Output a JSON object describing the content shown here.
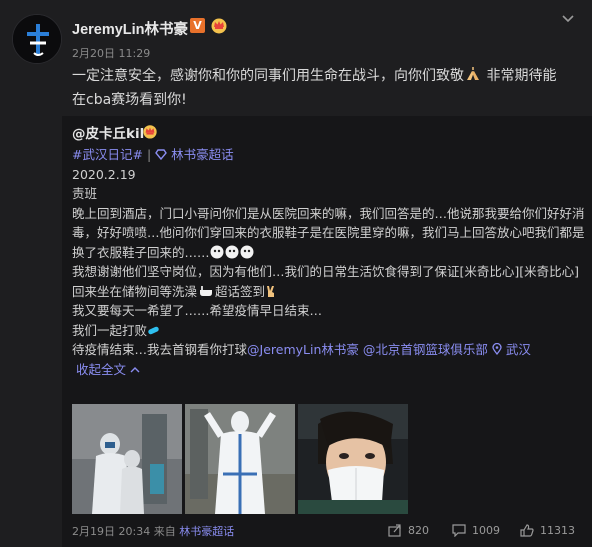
{
  "post": {
    "author": "JeremyLin林书豪",
    "verified_badge": "V",
    "timestamp": "2月20日 11:29",
    "text_line1": "一定注意安全，感谢你和你的同事们用生命在战斗，向你们致敬",
    "text_line1_tail": " 非常期待能",
    "text_line2": "在cba赛场看到你!",
    "expand_icon": "chevron-down-icon"
  },
  "repost": {
    "author": "@皮卡丘kilo",
    "topic1": "#武汉日记#",
    "topic2": "林书豪超话",
    "date": "2020.2.19",
    "shift": "责班",
    "para1_l1": "晚上回到酒店，门口小哥问你们是从医院回来的嘛，我们回答是的…他说那我要给你们好好消",
    "para1_l2": "毒，好好喷喷…他问你们穿回来的衣服鞋子是在医院里穿的嘛，我们马上回答放心吧我们都是",
    "para1_l3": "换了衣服鞋子回来的……",
    "para2_l1": "我想谢谢他们坚守岗位，因为有他们…我们的日常生活饮食得到了保证[米奇比心][米奇比心]",
    "para2_l2": "回来坐在储物间等洗澡",
    "para2_l2_tail": "超话签到",
    "para3": "我又要每天一希望了……希望疫情早日结束…",
    "para4": "我们一起打败",
    "para5_prefix": "待疫情结束…我去首钢看你打球",
    "mention1": "@JeremyLin林书豪",
    "mention2": "@北京首钢篮球俱乐部",
    "location": "武汉",
    "collapse": "收起全文",
    "footer_time": "2月19日 20:34 来自",
    "footer_source": "林书豪超话",
    "reposts": "820",
    "comments": "1009",
    "likes": "11313"
  },
  "colors": {
    "background": "#1e1e20",
    "repost_background": "#161618",
    "link": "#8a8df1",
    "muted": "#8b8b8b"
  }
}
